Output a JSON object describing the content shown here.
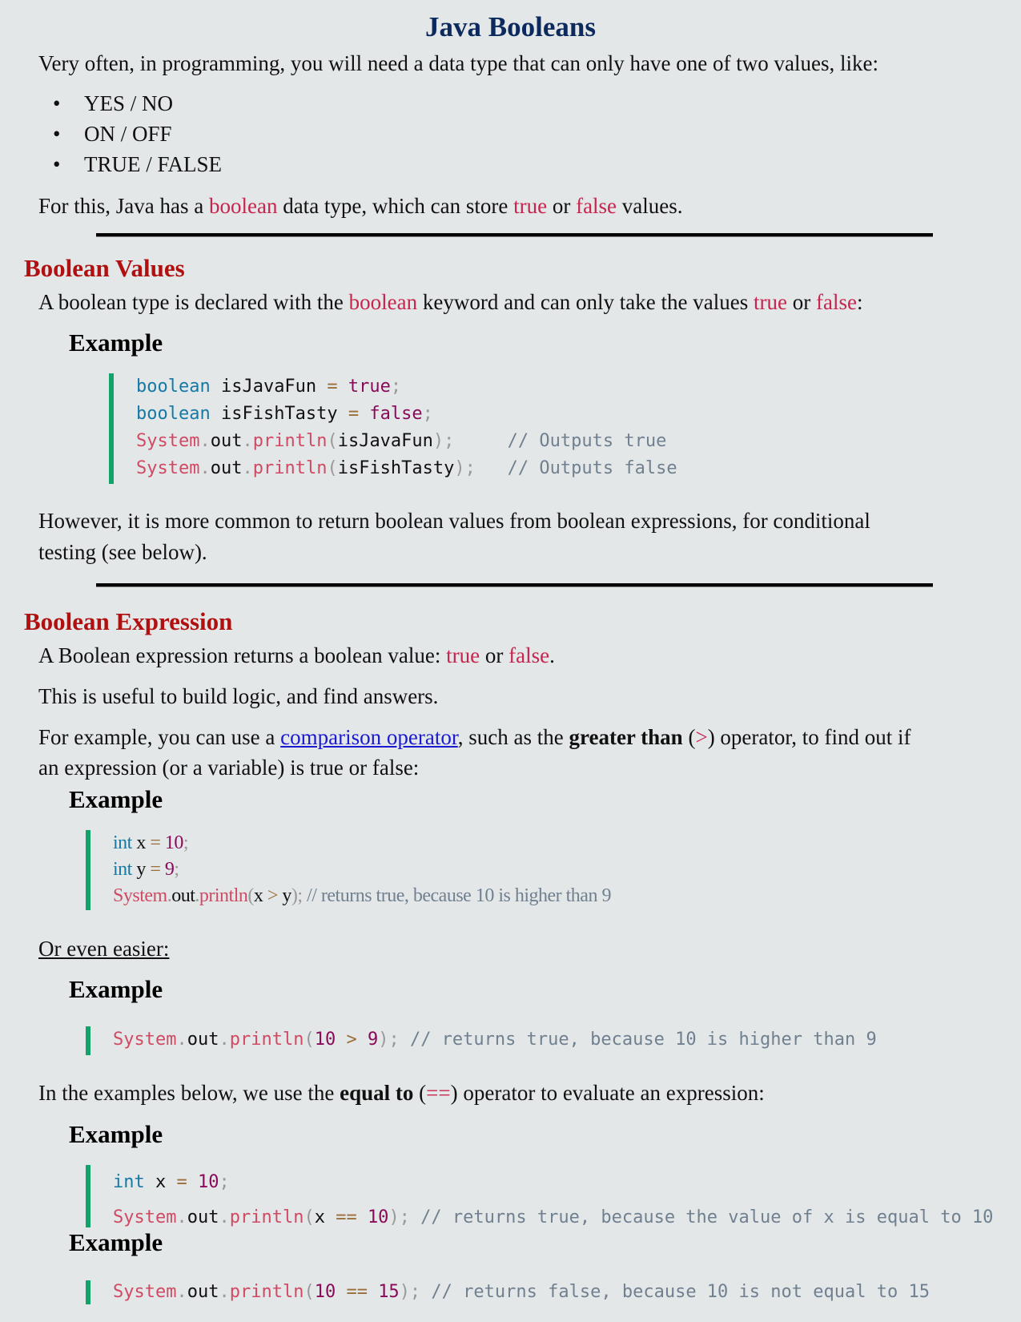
{
  "title": "Java Booleans",
  "intro": {
    "text": "Very often, in programming, you will need a data type that can only have one of two values, like:",
    "bullets": [
      "YES / NO",
      "ON / OFF",
      "TRUE / FALSE"
    ],
    "closing": {
      "pre": "For this, Java has a ",
      "kw1": "boolean",
      "mid1": " data type, which can store ",
      "kw2": "true",
      "mid2": " or ",
      "kw3": "false",
      "post": " values."
    }
  },
  "section1": {
    "heading": "Boolean Values",
    "desc": {
      "pre": "A boolean type is declared with the ",
      "kw1": "boolean",
      "mid1": " keyword and can only take the values ",
      "kw2": "true",
      "mid2": " or ",
      "kw3": "false",
      "post": ":"
    },
    "example_label": "Example",
    "code": [
      {
        "kw": "boolean",
        "name": " isJavaFun ",
        "op": "=",
        "val": " true",
        "end": ";"
      },
      {
        "kw": "boolean",
        "name": " isFishTasty ",
        "op": "=",
        "val": " false",
        "end": ";"
      },
      {
        "cls": "System",
        "dot1": ".",
        "out": "out",
        "dot2": ".",
        "fn": "println",
        "open": "(",
        "arg": "isJavaFun",
        "close": ");",
        "pad": "     ",
        "comment": "// Outputs true"
      },
      {
        "cls": "System",
        "dot1": ".",
        "out": "out",
        "dot2": ".",
        "fn": "println",
        "open": "(",
        "arg": "isFishTasty",
        "close": ");",
        "pad": "   ",
        "comment": "// Outputs false"
      }
    ],
    "after": [
      "However, it is more common to return boolean values from boolean expressions, for conditional",
      "testing (see below)."
    ]
  },
  "section2": {
    "heading": "Boolean Expression",
    "p1": {
      "pre": "A Boolean expression returns a boolean value: ",
      "kw1": "true",
      "mid": " or ",
      "kw2": "false",
      "post": "."
    },
    "p2": "This is useful to build logic, and find answers.",
    "p3": {
      "pre": "For example, you can use a ",
      "link": "comparison operator",
      "mid": ", such as the ",
      "bold": "greater than",
      "open": " (",
      "op": ">",
      "post": ") operator, to find out if",
      "line2": "an expression (or a variable) is true or false:"
    },
    "example1": {
      "label": "Example",
      "lines": [
        {
          "kw": "int",
          "name": " x ",
          "op": "=",
          "val": " 10",
          "end": ";"
        },
        {
          "kw": "int",
          "name": " y ",
          "op": "=",
          "val": " 9",
          "end": ";"
        },
        {
          "cls": "System",
          "out": "out",
          "fn": "println",
          "a": "x",
          "op": " > ",
          "b": "y",
          "close": ");",
          "comment": " // returns true, because 10 is higher than 9"
        }
      ]
    },
    "easier": "Or even easier:",
    "example2": {
      "label": "Example",
      "line": {
        "cls": "System",
        "out": "out",
        "fn": "println",
        "a": "10",
        "op": " > ",
        "b": "9",
        "close": ");",
        "comment": " // returns true, because 10 is higher than 9"
      }
    },
    "p4": {
      "pre": "In the examples below, we use the ",
      "bold": "equal to",
      "open": " (",
      "op": "==",
      "post": ") operator to evaluate an expression:"
    },
    "example3": {
      "label": "Example",
      "lines": [
        {
          "kw": "int",
          "name": " x ",
          "op": "=",
          "val": " 10",
          "end": ";"
        },
        {
          "cls": "System",
          "out": "out",
          "fn": "println",
          "a": "x",
          "op": " == ",
          "b": "10",
          "close": ");",
          "comment": " // returns true, because the value of x is equal to 10"
        }
      ]
    },
    "example4": {
      "label": "Example",
      "line": {
        "cls": "System",
        "out": "out",
        "fn": "println",
        "a": "10",
        "op": " == ",
        "b": "15",
        "close": ");",
        "comment": " // returns false, because 10 is not equal to 15"
      }
    }
  }
}
